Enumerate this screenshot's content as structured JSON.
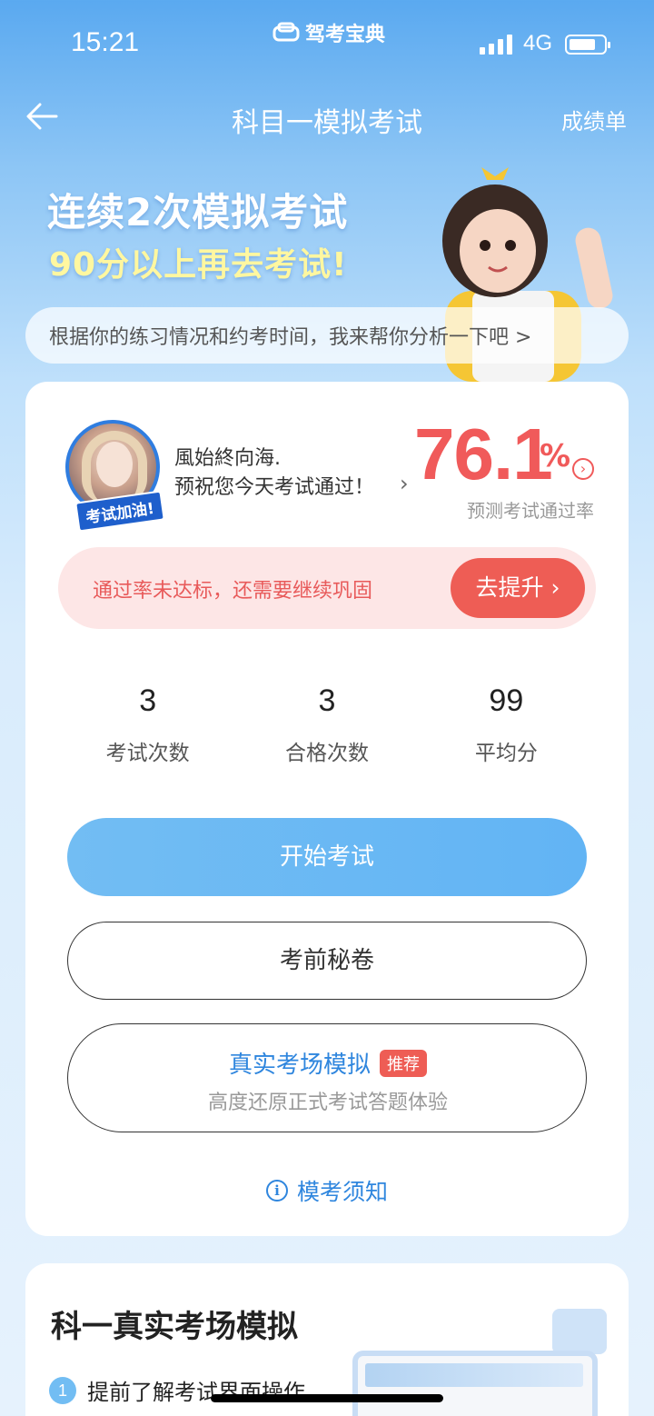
{
  "status_bar": {
    "time": "15:21",
    "app_brand": "驾考宝典",
    "network": "4G"
  },
  "nav": {
    "title": "科目一模拟考试",
    "right_link": "成绩单"
  },
  "promo": {
    "line1": "连续2次模拟考试",
    "line2": "90分以上再去考试!"
  },
  "analysis_bar": {
    "text": "根据你的练习情况和约考时间，我来帮你分析一下吧 >"
  },
  "profile": {
    "username": "風始終向海.",
    "wish": "预祝您今天考试通过！",
    "avatar_badge": "考试加油!",
    "pass_rate": 76.1,
    "pass_rate_text": "76.1",
    "pass_rate_unit": "%",
    "pass_rate_label": "预测考试通过率"
  },
  "warning": {
    "text": "通过率未达标，还需要继续巩固",
    "button": "去提升"
  },
  "stats": [
    {
      "value": "3",
      "label": "考试次数"
    },
    {
      "value": "3",
      "label": "合格次数"
    },
    {
      "value": "99",
      "label": "平均分"
    }
  ],
  "buttons": {
    "start": "开始考试",
    "secret": "考前秘卷",
    "real_title": "真实考场模拟",
    "real_badge": "推荐",
    "real_sub": "高度还原正式考试答题体验",
    "notice": "模考须知"
  },
  "section2": {
    "title": "科一真实考场模拟",
    "step_num": "1",
    "step_text": "提前了解考试界面操作"
  },
  "colors": {
    "accent_blue": "#2f86de",
    "warn_red": "#ee5d55",
    "start_btn": "#6bb9f3"
  }
}
